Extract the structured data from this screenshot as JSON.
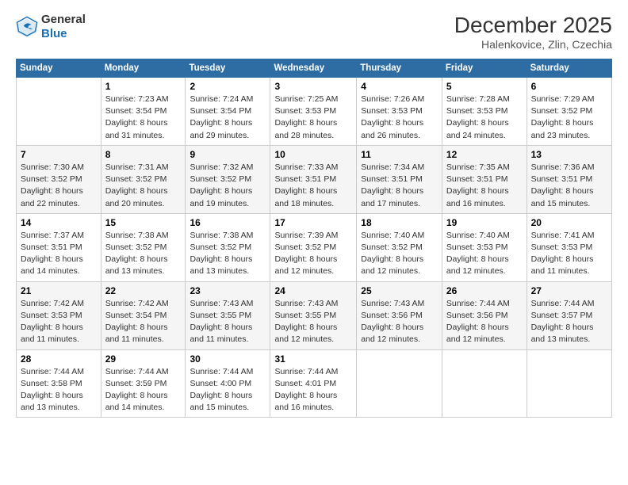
{
  "logo": {
    "line1": "General",
    "line2": "Blue"
  },
  "title": "December 2025",
  "subtitle": "Halenkovice, Zlin, Czechia",
  "days_header": [
    "Sunday",
    "Monday",
    "Tuesday",
    "Wednesday",
    "Thursday",
    "Friday",
    "Saturday"
  ],
  "weeks": [
    [
      {
        "num": "",
        "info": ""
      },
      {
        "num": "1",
        "info": "Sunrise: 7:23 AM\nSunset: 3:54 PM\nDaylight: 8 hours\nand 31 minutes."
      },
      {
        "num": "2",
        "info": "Sunrise: 7:24 AM\nSunset: 3:54 PM\nDaylight: 8 hours\nand 29 minutes."
      },
      {
        "num": "3",
        "info": "Sunrise: 7:25 AM\nSunset: 3:53 PM\nDaylight: 8 hours\nand 28 minutes."
      },
      {
        "num": "4",
        "info": "Sunrise: 7:26 AM\nSunset: 3:53 PM\nDaylight: 8 hours\nand 26 minutes."
      },
      {
        "num": "5",
        "info": "Sunrise: 7:28 AM\nSunset: 3:53 PM\nDaylight: 8 hours\nand 24 minutes."
      },
      {
        "num": "6",
        "info": "Sunrise: 7:29 AM\nSunset: 3:52 PM\nDaylight: 8 hours\nand 23 minutes."
      }
    ],
    [
      {
        "num": "7",
        "info": "Sunrise: 7:30 AM\nSunset: 3:52 PM\nDaylight: 8 hours\nand 22 minutes."
      },
      {
        "num": "8",
        "info": "Sunrise: 7:31 AM\nSunset: 3:52 PM\nDaylight: 8 hours\nand 20 minutes."
      },
      {
        "num": "9",
        "info": "Sunrise: 7:32 AM\nSunset: 3:52 PM\nDaylight: 8 hours\nand 19 minutes."
      },
      {
        "num": "10",
        "info": "Sunrise: 7:33 AM\nSunset: 3:51 PM\nDaylight: 8 hours\nand 18 minutes."
      },
      {
        "num": "11",
        "info": "Sunrise: 7:34 AM\nSunset: 3:51 PM\nDaylight: 8 hours\nand 17 minutes."
      },
      {
        "num": "12",
        "info": "Sunrise: 7:35 AM\nSunset: 3:51 PM\nDaylight: 8 hours\nand 16 minutes."
      },
      {
        "num": "13",
        "info": "Sunrise: 7:36 AM\nSunset: 3:51 PM\nDaylight: 8 hours\nand 15 minutes."
      }
    ],
    [
      {
        "num": "14",
        "info": "Sunrise: 7:37 AM\nSunset: 3:51 PM\nDaylight: 8 hours\nand 14 minutes."
      },
      {
        "num": "15",
        "info": "Sunrise: 7:38 AM\nSunset: 3:52 PM\nDaylight: 8 hours\nand 13 minutes."
      },
      {
        "num": "16",
        "info": "Sunrise: 7:38 AM\nSunset: 3:52 PM\nDaylight: 8 hours\nand 13 minutes."
      },
      {
        "num": "17",
        "info": "Sunrise: 7:39 AM\nSunset: 3:52 PM\nDaylight: 8 hours\nand 12 minutes."
      },
      {
        "num": "18",
        "info": "Sunrise: 7:40 AM\nSunset: 3:52 PM\nDaylight: 8 hours\nand 12 minutes."
      },
      {
        "num": "19",
        "info": "Sunrise: 7:40 AM\nSunset: 3:53 PM\nDaylight: 8 hours\nand 12 minutes."
      },
      {
        "num": "20",
        "info": "Sunrise: 7:41 AM\nSunset: 3:53 PM\nDaylight: 8 hours\nand 11 minutes."
      }
    ],
    [
      {
        "num": "21",
        "info": "Sunrise: 7:42 AM\nSunset: 3:53 PM\nDaylight: 8 hours\nand 11 minutes."
      },
      {
        "num": "22",
        "info": "Sunrise: 7:42 AM\nSunset: 3:54 PM\nDaylight: 8 hours\nand 11 minutes."
      },
      {
        "num": "23",
        "info": "Sunrise: 7:43 AM\nSunset: 3:55 PM\nDaylight: 8 hours\nand 11 minutes."
      },
      {
        "num": "24",
        "info": "Sunrise: 7:43 AM\nSunset: 3:55 PM\nDaylight: 8 hours\nand 12 minutes."
      },
      {
        "num": "25",
        "info": "Sunrise: 7:43 AM\nSunset: 3:56 PM\nDaylight: 8 hours\nand 12 minutes."
      },
      {
        "num": "26",
        "info": "Sunrise: 7:44 AM\nSunset: 3:56 PM\nDaylight: 8 hours\nand 12 minutes."
      },
      {
        "num": "27",
        "info": "Sunrise: 7:44 AM\nSunset: 3:57 PM\nDaylight: 8 hours\nand 13 minutes."
      }
    ],
    [
      {
        "num": "28",
        "info": "Sunrise: 7:44 AM\nSunset: 3:58 PM\nDaylight: 8 hours\nand 13 minutes."
      },
      {
        "num": "29",
        "info": "Sunrise: 7:44 AM\nSunset: 3:59 PM\nDaylight: 8 hours\nand 14 minutes."
      },
      {
        "num": "30",
        "info": "Sunrise: 7:44 AM\nSunset: 4:00 PM\nDaylight: 8 hours\nand 15 minutes."
      },
      {
        "num": "31",
        "info": "Sunrise: 7:44 AM\nSunset: 4:01 PM\nDaylight: 8 hours\nand 16 minutes."
      },
      {
        "num": "",
        "info": ""
      },
      {
        "num": "",
        "info": ""
      },
      {
        "num": "",
        "info": ""
      }
    ]
  ]
}
